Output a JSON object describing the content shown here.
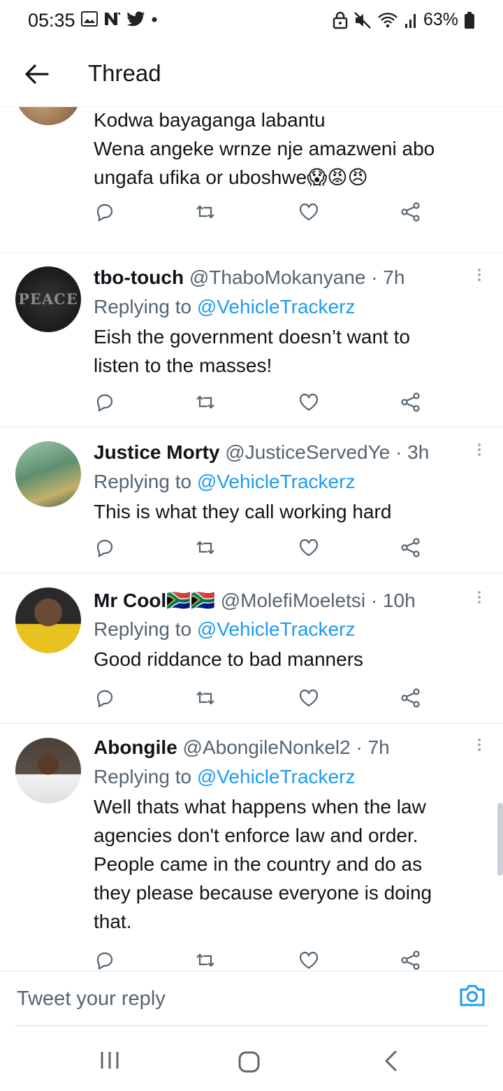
{
  "status_bar": {
    "time": "05:35",
    "battery": "63%",
    "left_icons": [
      "image-icon",
      "n-icon",
      "twitter-icon",
      "dot-icon"
    ],
    "right_icons": [
      "lock-icon",
      "mute-icon",
      "wifi-icon",
      "signal-icon",
      "battery-icon"
    ]
  },
  "header": {
    "title": "Thread"
  },
  "tweets": [
    {
      "name": "",
      "handle": "",
      "time": "",
      "reply_prefix": "",
      "reply_to": "",
      "body_lines": [
        "Kodwa bayaganga labantu",
        "Wena angeke wrnze nje amazweni abo",
        "ungafa ufika or uboshwe😱😡😠"
      ],
      "avatar_colors": [
        "#b58a5a",
        "#6b4a2e"
      ]
    },
    {
      "name": "tbo-touch",
      "handle": "@ThaboMokanyane",
      "time": "· 7h",
      "reply_prefix": "Replying to ",
      "reply_to": "@VehicleTrackerz",
      "body_lines": [
        "Eish the government doesn’t want to",
        "listen to the masses!"
      ],
      "avatar_text": "PEACE",
      "avatar_colors": [
        "#2a2a2a",
        "#111111"
      ]
    },
    {
      "name": "Justice Morty",
      "handle": "@JusticeServedYe",
      "time": "· 3h",
      "reply_prefix": "Replying to ",
      "reply_to": "@VehicleTrackerz",
      "body_lines": [
        "This is what they call working hard"
      ],
      "avatar_colors": [
        "#8fb7a0",
        "#4d7a5e"
      ]
    },
    {
      "name": "Mr Cool🇿🇦🇿🇦",
      "handle": "@MolefiMoeletsi",
      "time": "· 10h",
      "reply_prefix": "Replying to ",
      "reply_to": "@VehicleTrackerz",
      "body_lines": [
        "Good riddance to bad manners"
      ],
      "avatar_colors": [
        "#e9c21f",
        "#3a2a1a"
      ]
    },
    {
      "name": "Abongile",
      "handle": "@AbongileNonkel2",
      "time": "· 7h",
      "reply_prefix": "Replying to ",
      "reply_to": "@VehicleTrackerz",
      "body_lines": [
        "Well thats what happens when the law",
        "agencies don't enforce law and order.",
        "People came in the country  and do as",
        "they please because everyone is doing",
        "that."
      ],
      "avatar_colors": [
        "#6a5a4a",
        "#2b2520"
      ]
    }
  ],
  "action_icons": [
    "reply-icon",
    "retweet-icon",
    "like-icon",
    "share-icon"
  ],
  "composer": {
    "placeholder": "Tweet your reply"
  },
  "colors": {
    "link": "#1d9bf0",
    "secondary": "#536471",
    "text": "#0f1419"
  }
}
